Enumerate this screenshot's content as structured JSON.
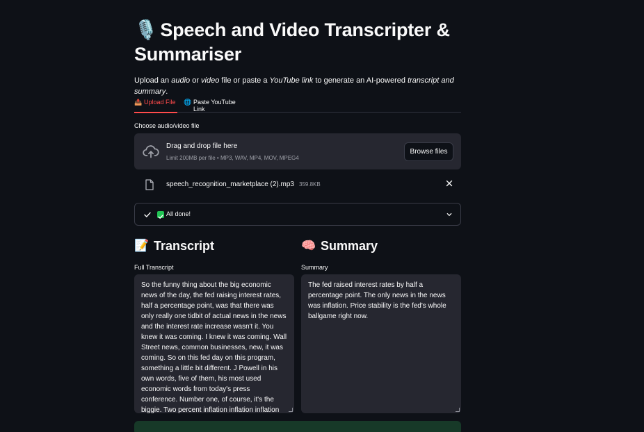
{
  "app": {
    "title_emoji": "🎙️",
    "title": "Speech and Video Transcripter & Summariser",
    "subtitle": {
      "p1": "Upload an ",
      "audio": "audio",
      "p2": " or ",
      "video": "video",
      "p3": " file or paste a ",
      "youtube": "YouTube link",
      "p4": " to generate an AI-powered ",
      "ts": "transcript and summary",
      "p5": "."
    }
  },
  "tabs": [
    {
      "icon": "📤",
      "label": "Upload File",
      "active": true
    },
    {
      "icon": "🌐",
      "label": "Paste YouTube Link",
      "active": false
    }
  ],
  "uploader": {
    "label": "Choose audio/video file",
    "drop_title": "Drag and drop file here",
    "drop_limit": "Limit 200MB per file • MP3, WAV, MP4, MOV, MPEG4",
    "browse_label": "Browse files",
    "icon": "cloud-upload-icon"
  },
  "file": {
    "name": "speech_recognition_marketplace (2).mp3",
    "size": "359.8KB",
    "icon": "file-icon"
  },
  "status": {
    "text": "All done!",
    "color": "#21c354"
  },
  "transcript": {
    "emoji": "📝",
    "heading": "Transcript",
    "label": "Full Transcript",
    "text": " So the funny thing about the big economic news of the day, the fed raising interest rates, half a percentage point, was that there was only really one tidbit of actual news in the news and the interest rate increase wasn't it. You knew it was coming. I knew it was coming. Wall Street news, common businesses, new, it was coming. So on this fed day on this program, something a little bit different. J Powell in his own words, five of them, his most used economic words from today's press conference. Number one, of course, it's the biggie. Two percent inflation inflation inflation"
  },
  "summary": {
    "emoji": "🧠",
    "heading": "Summary",
    "label": "Summary",
    "text": "The fed raised interest rates by half a percentage point. The only news in the news was inflation. Price stability is the fed's whole ballgame right now."
  },
  "colors": {
    "background": "#0e1117",
    "accent": "#ff4b4b",
    "panel": "#262730",
    "success": "#21c354"
  }
}
